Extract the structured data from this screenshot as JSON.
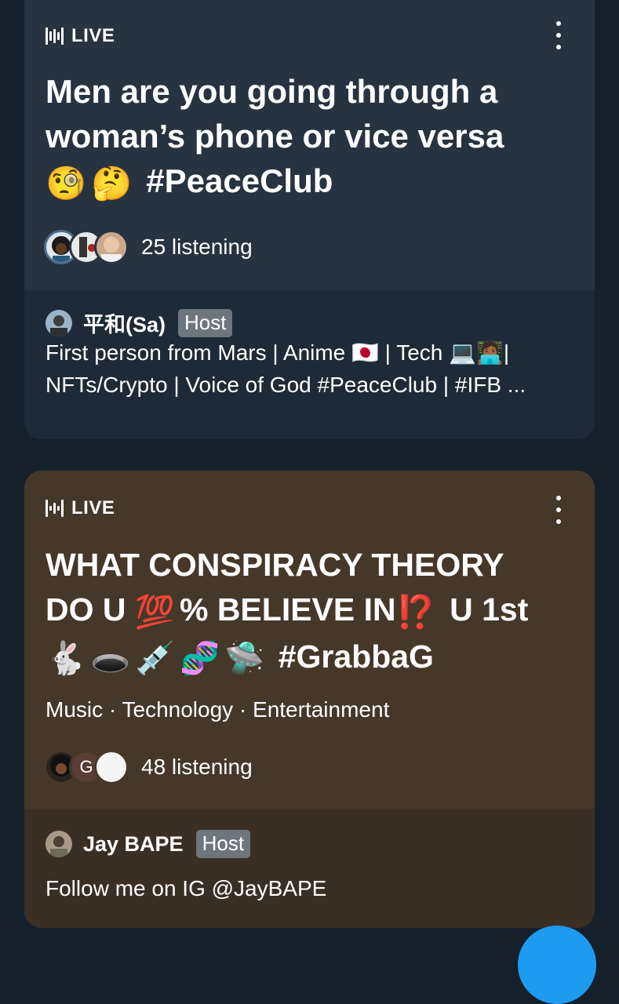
{
  "spaces": [
    {
      "live_label": "LIVE",
      "title": "Men are you going through a woman’s phone or vice versa",
      "title_tag": "#PeaceClub",
      "title_emojis": [
        "🧐",
        "🤔"
      ],
      "listening": "25 listening",
      "host": {
        "name": "平和(Sa)",
        "badge": "Host",
        "bio_line1": "First person from Mars | Anime 🇯🇵 | Tech 💻🧑🏾‍💻|",
        "bio_line2": "NFTs/Crypto | Voice of God #PeaceClub | #IFB ..."
      },
      "colors": {
        "card": "#273340",
        "host_section": "#1e2a37"
      }
    },
    {
      "live_label": "LIVE",
      "title_line1": "WHAT CONSPIRACY THEORY",
      "title_line2_a": "DO U",
      "title_line2_b": "% BELIEVE IN",
      "title_line2_c": "U 1st",
      "emoji_100": "💯",
      "emoji_bang": "⁉️",
      "title_emojis": [
        "🐇",
        "🕳️",
        "💉",
        "🧬",
        "🛸"
      ],
      "title_tag": "#GrabbaG",
      "topics": "Music · Technology · Entertainment",
      "avatar_letter": "G",
      "listening": "48 listening",
      "host": {
        "name": "Jay BAPE",
        "badge": "Host",
        "bio": "Follow me on IG @JayBAPE"
      },
      "colors": {
        "card": "#453829",
        "host_section": "#3a2f24"
      }
    }
  ],
  "colors": {
    "background": "#15202b",
    "badge": "#6e767d",
    "fab": "#1d9bf0"
  }
}
